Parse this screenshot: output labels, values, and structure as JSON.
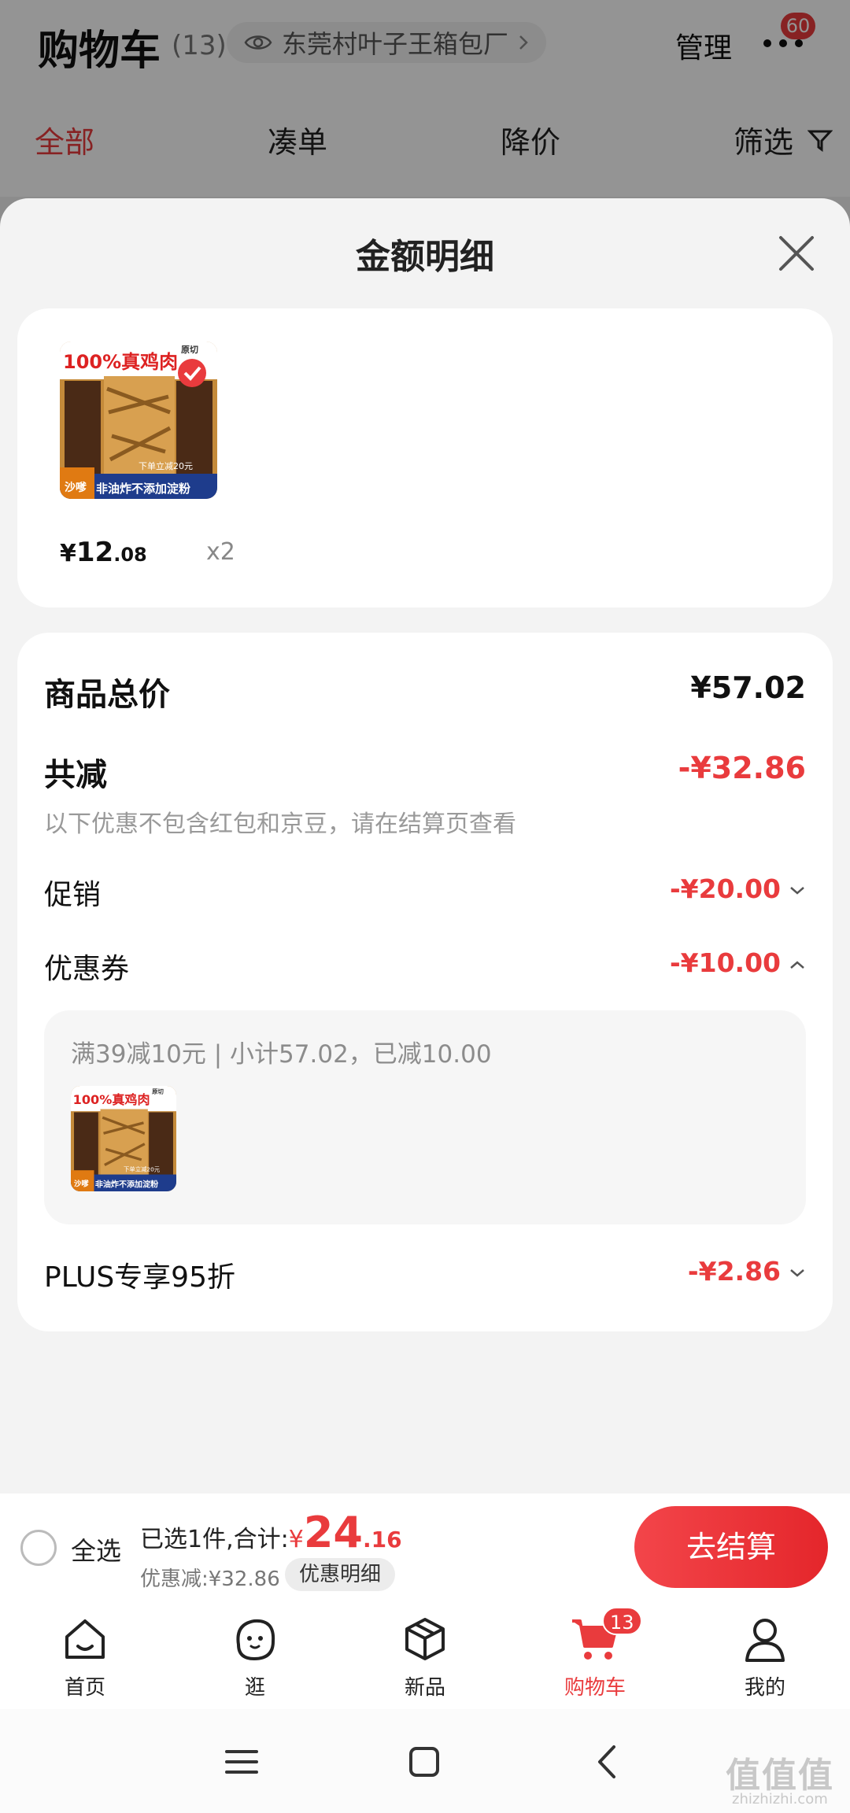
{
  "cart_page": {
    "title": "购物车",
    "count": "(13)",
    "store_name": "东莞村叶子王箱包厂",
    "manage_label": "管理",
    "message_badge": "60",
    "tabs": [
      {
        "label": "全部",
        "active": true
      },
      {
        "label": "凑单",
        "active": false
      },
      {
        "label": "降价",
        "active": false
      },
      {
        "label": "筛选",
        "active": false
      }
    ]
  },
  "sheet": {
    "title": "金额明细",
    "product": {
      "thumb_headline": "100%真鸡肉",
      "thumb_tag": "原切",
      "thumb_brand": "沙嗲",
      "thumb_footer": "非油炸不添加淀粉",
      "thumb_promo": "下单立减20元",
      "price_symbol": "¥",
      "price_int": "12",
      "price_dec": ".08",
      "quantity": "x2"
    },
    "summary": {
      "total_label": "商品总价",
      "total_value": "¥57.02",
      "discount_label": "共减",
      "discount_value": "-¥32.86",
      "note": "以下优惠不包含红包和京豆，请在结算页查看",
      "promo_label": "促销",
      "promo_value": "-¥20.00",
      "coupon_label": "优惠券",
      "coupon_value": "-¥10.00",
      "coupon_desc": "满39减10元 | 小计57.02，已减10.00",
      "plus_label": "PLUS专享95折",
      "plus_value": "-¥2.86"
    }
  },
  "checkout": {
    "select_all": "全选",
    "selected_text": "已选1件,合计:",
    "total_symbol": "¥",
    "total_int": "24",
    "total_dec": ".16",
    "saved_text": "优惠减:¥32.86",
    "detail_button": "优惠明细",
    "checkout_button": "去结算"
  },
  "bottom_nav": {
    "items": [
      {
        "label": "首页",
        "icon": "home-icon"
      },
      {
        "label": "逛",
        "icon": "face-icon"
      },
      {
        "label": "新品",
        "icon": "cube-icon"
      },
      {
        "label": "购物车",
        "icon": "cart-icon",
        "active": true
      },
      {
        "label": "我的",
        "icon": "user-icon"
      }
    ],
    "cart_badge": "13"
  },
  "watermark": {
    "text": "值值值",
    "sub": "zhizhizhi.com"
  },
  "colors": {
    "accent": "#e93b3d",
    "sheet_bg": "#f3f3f3"
  }
}
